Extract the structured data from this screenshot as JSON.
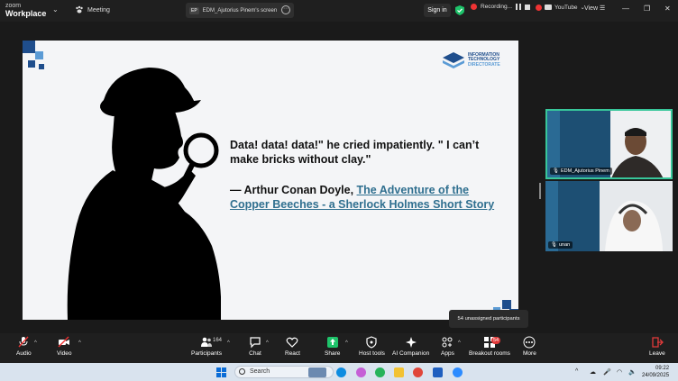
{
  "titlebar": {
    "brand_top": "zoom",
    "brand_bottom": "Workplace",
    "meeting_label": "Meeting",
    "share_tag": "EP",
    "share_title": "EDM_Ajutorius Pinem's screen",
    "signin_label": "Sign in",
    "recording_label": "Recording...",
    "youtube_label": "YouTube",
    "view_label": "View"
  },
  "slide": {
    "logo_line1": "INFORMATION",
    "logo_line2": "TECHNOLOGY",
    "logo_line3": "DIRECTORATE",
    "quote": "Data! data! data!\" he cried impatiently. \" I can’t make bricks without clay.\"",
    "author_prefix": "— Arthur Conan Doyle,",
    "author_link": "The Adventure of the Copper Beeches - a Sherlock Holmes Short Story"
  },
  "participants": [
    {
      "name": "EDM_Ajutorius Pinem"
    },
    {
      "name": "unan"
    }
  ],
  "tooltip": "54 unassigned participants",
  "toolbar": {
    "audio": "Audio",
    "video": "Video",
    "participants": "Participants",
    "participants_count": "164",
    "chat": "Chat",
    "react": "React",
    "share": "Share",
    "host_tools": "Host tools",
    "ai_companion": "AI Companion",
    "apps": "Apps",
    "breakout": "Breakout rooms",
    "breakout_badge": "54",
    "more": "More",
    "leave": "Leave"
  },
  "taskbar": {
    "search_placeholder": "Search",
    "time": "09:22",
    "date": "24/09/2025"
  },
  "colors": {
    "accent_green": "#38c79a",
    "share_green": "#1ec36a",
    "leave_red": "#e03a3a",
    "link_teal": "#2f6f8f"
  }
}
